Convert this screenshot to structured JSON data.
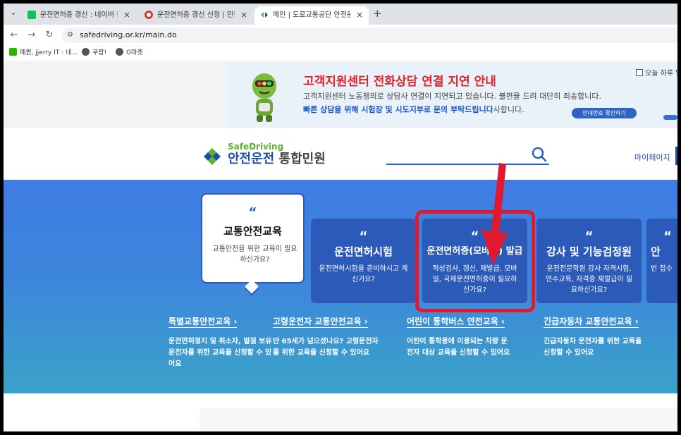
{
  "browser": {
    "tabs": [
      {
        "title": "운전면허증 갱신 : 네이버 통합",
        "favicon_color": "#03c75a",
        "active": false
      },
      {
        "title": "운전면허증 갱신 신청 | 민원안내",
        "favicon_color": "#d33b3b",
        "active": false
      },
      {
        "title": "메인 | 도로교통공단 안전운전",
        "favicon_color": "#5ab52b",
        "active": true
      }
    ],
    "tab_close": "×",
    "new_tab": "+",
    "tab_menu": "⌄",
    "url": "safedriving.or.kr/main.do",
    "bookmarks": [
      {
        "label": "페퀸, jjerry IT : 네..."
      },
      {
        "label": "쿠팡!"
      },
      {
        "label": "G마켓"
      }
    ]
  },
  "notice": {
    "title": "고객지원센터 전화상담 연결 지연 안내",
    "line1": "고객지원센터 노동쟁의로 상담사 연결이 지연되고 있습니다. 불편을 드려 대단히 죄송합니다.",
    "line2_highlight": "빠른 상담을 위해 시험장 및 시도지부로 문의 부탁드립니다",
    "line2_rest": "사합니다.",
    "button": "안내번호 확인하기",
    "today_close": "오늘 하루 열"
  },
  "header": {
    "logo_sub": "SafeDriving",
    "logo_main": "안전운전",
    "logo_suffix": "통합민원",
    "mypage": "마이페이지"
  },
  "cards": [
    {
      "quote": "“",
      "title": "교통안전교육",
      "desc": "교통안전을 위한 교육이 필요하신가요?"
    },
    {
      "quote": "“",
      "title": "운전면허시험",
      "desc": "운전면허시험을 준비하시고 계신가요?"
    },
    {
      "quote": "“",
      "title": "운전면허증(모바일) 발급",
      "desc": "적성검사, 갱신, 재발급, 모바일, 국제운전면허증이 필요하신가요?"
    },
    {
      "quote": "“",
      "title": "강사 및 기능검정원",
      "desc": "운전전문학원 강사 자격시험, 연수교육, 자격증 재발급이 필요하신가요?"
    },
    {
      "quote": "“",
      "title": "안",
      "desc": "번 접수"
    }
  ],
  "links": [
    {
      "title": "특별교통안전교육 ›",
      "desc": "운전면허정지 및 취소자, 벌점 보유 운전자를 위한 교육을 신청할 수 있어요"
    },
    {
      "title": "고령운전자 교통안전교육 ›",
      "desc": "만 65세가 넘으셨나요? 고령운전자를 위한 교육을 신청할 수 있어요"
    },
    {
      "title": "어린이 통학버스 안전교육 ›",
      "desc": "어린이 통학용에 이용되는 차량 운전자 대상 교육을 신청할 수 있어요"
    },
    {
      "title": "긴급자동차 교통안전교육 ›",
      "desc": "긴급자동차 운전자를 위한 교육을 신청할 수 있어요"
    }
  ],
  "colors": {
    "brand_blue": "#2c5ab9",
    "brand_green": "#5ab52b",
    "notice_red": "#e0242c",
    "highlight_red": "#e2192e"
  },
  "icons": [
    "menu-chevron-icon",
    "back-arrow-icon",
    "forward-arrow-icon",
    "reload-icon",
    "site-info-icon",
    "search-icon",
    "mascot-icon",
    "logo-clover-icon",
    "red-arrow-annotation"
  ]
}
